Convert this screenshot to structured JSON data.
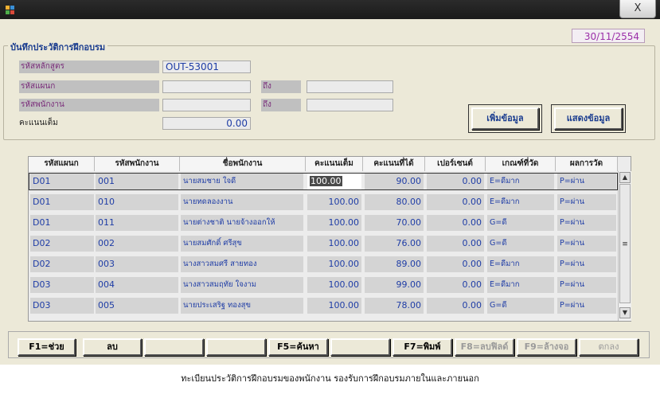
{
  "date": "30/11/2554",
  "close_label": "X",
  "group_title": "บันทึกประวัติการฝึกอบรม",
  "form": {
    "course_label": "รหัสหลักสูตร",
    "course_value": "OUT-53001",
    "dept_label": "รหัสแผนก",
    "dept_to_label": "ถึง",
    "emp_label": "รหัสพนักงาน",
    "emp_to_label": "ถึง",
    "score_label": "คะแนนเต็ม",
    "score_value": "0.00"
  },
  "buttons": {
    "add": "เพิ่มข้อมูล",
    "show": "แสดงข้อมูล"
  },
  "table": {
    "columns": [
      "รหัสแผนก",
      "รหัสพนักงาน",
      "ชื่อพนักงาน",
      "คะแนนเต็ม",
      "คะแนนที่ได้",
      "เปอร์เซนต์",
      "เกณฑ์ที่วัด",
      "ผลการวัด"
    ],
    "rows": [
      {
        "dept": "D01",
        "emp": "001",
        "name": "นายสมชาย ใจดี",
        "full": "100.00",
        "got": "90.00",
        "pct": "0.00",
        "crit": "E=ดีมาก",
        "result": "P=ผ่าน"
      },
      {
        "dept": "D01",
        "emp": "010",
        "name": "นายทดลองงาน",
        "full": "100.00",
        "got": "80.00",
        "pct": "0.00",
        "crit": "E=ดีมาก",
        "result": "P=ผ่าน"
      },
      {
        "dept": "D01",
        "emp": "011",
        "name": "นายต่างชาติ นายจ้างออกให้",
        "full": "100.00",
        "got": "70.00",
        "pct": "0.00",
        "crit": "G=ดี",
        "result": "P=ผ่าน"
      },
      {
        "dept": "D02",
        "emp": "002",
        "name": "นายสมศักดิ์ ศรีสุข",
        "full": "100.00",
        "got": "76.00",
        "pct": "0.00",
        "crit": "G=ดี",
        "result": "P=ผ่าน"
      },
      {
        "dept": "D02",
        "emp": "003",
        "name": "นางสาวสมศรี สายทอง",
        "full": "100.00",
        "got": "89.00",
        "pct": "0.00",
        "crit": "E=ดีมาก",
        "result": "P=ผ่าน"
      },
      {
        "dept": "D03",
        "emp": "004",
        "name": "นางสาวสมฤทัย ใจงาม",
        "full": "100.00",
        "got": "99.00",
        "pct": "0.00",
        "crit": "E=ดีมาก",
        "result": "P=ผ่าน"
      },
      {
        "dept": "D03",
        "emp": "005",
        "name": "นายประเสริฐ ทองสุข",
        "full": "100.00",
        "got": "78.00",
        "pct": "0.00",
        "crit": "G=ดี",
        "result": "P=ผ่าน"
      }
    ]
  },
  "footer": {
    "f1": "F1=ช่วย",
    "del": "ลบ",
    "f5": "F5=ค้นหา",
    "f7": "F7=พิมพ์",
    "f8": "F8=ลบฟิลด์",
    "f9": "F9=ล้างจอ",
    "ok": "ตกลง"
  },
  "status_text": "ทะเบียนประวัติการฝึกอบรมของพนักงาน รองรับการฝึกอบรมภายในและภายนอก",
  "colors": {
    "accent": "#1f3da6",
    "label": "#7a2c7a",
    "date": "#9b2fa8"
  }
}
